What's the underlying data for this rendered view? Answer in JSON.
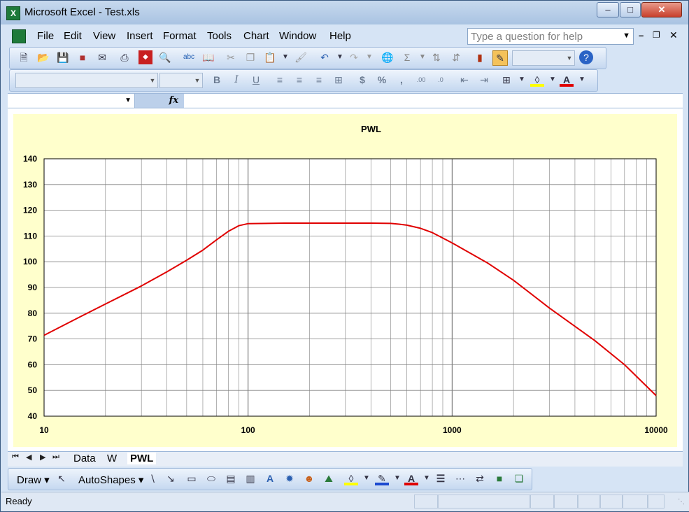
{
  "window": {
    "title": "Microsoft Excel - Test.xls"
  },
  "menu": [
    "File",
    "Edit",
    "View",
    "Insert",
    "Format",
    "Tools",
    "Chart",
    "Window",
    "Help"
  ],
  "help": {
    "placeholder": "Type a question for help"
  },
  "drawing": {
    "draw_label": "Draw",
    "autoshapes_label": "AutoShapes"
  },
  "sheet_tabs": {
    "tab1": "Data",
    "tab2": "W",
    "tab3": "PWL",
    "active": "PWL"
  },
  "status": {
    "text": "Ready"
  },
  "chart_data": {
    "type": "line",
    "title": "PWL",
    "xscale": "log",
    "xlim": [
      10,
      10000
    ],
    "ylim": [
      40,
      140
    ],
    "xticks": [
      "10",
      "100",
      "1000",
      "10000"
    ],
    "yticks": [
      "40",
      "50",
      "60",
      "70",
      "80",
      "90",
      "100",
      "110",
      "120",
      "130",
      "140"
    ],
    "grid": true,
    "legend": "none",
    "color": "#e00000",
    "series": [
      {
        "x": [
          10,
          15,
          20,
          30,
          40,
          50,
          60,
          70,
          80,
          90,
          100,
          150,
          200,
          300,
          400,
          500,
          550,
          600,
          700,
          800,
          1000,
          1500,
          2000,
          3000,
          5000,
          7000,
          10000
        ],
        "values": [
          71.4,
          78.6,
          83.6,
          90.6,
          96.1,
          100.6,
          104.5,
          108.5,
          111.8,
          114.0,
          114.8,
          115.0,
          115.0,
          115.0,
          115.0,
          114.9,
          114.6,
          114.2,
          113.0,
          111.3,
          107.3,
          99.4,
          92.8,
          82.0,
          69.4,
          60.0,
          48.0
        ]
      }
    ]
  }
}
